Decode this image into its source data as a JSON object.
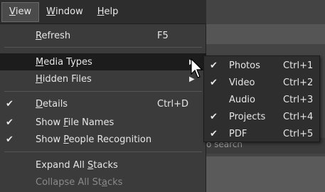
{
  "menubar": {
    "items": [
      {
        "label": "View",
        "active": true
      },
      {
        "label": "Window",
        "active": false
      },
      {
        "label": "Help",
        "active": false
      }
    ]
  },
  "view_menu": {
    "refresh": {
      "label": "Refresh",
      "shortcut": "F5"
    },
    "media_types": {
      "label": "Media Types"
    },
    "hidden_files": {
      "label": "Hidden Files"
    },
    "details": {
      "label": "Details",
      "shortcut": "Ctrl+D",
      "checked": true
    },
    "show_file_names": {
      "label": "Show File Names",
      "checked": true
    },
    "show_people_recognition": {
      "label": "Show People Recognition",
      "checked": true
    },
    "expand_all_stacks": {
      "label": "Expand All Stacks"
    },
    "collapse_all_stacks": {
      "label": "Collapse All Stacks",
      "disabled": true
    }
  },
  "media_types_submenu": {
    "items": [
      {
        "label": "Photos",
        "shortcut": "Ctrl+1",
        "checked": true
      },
      {
        "label": "Video",
        "shortcut": "Ctrl+2",
        "checked": true
      },
      {
        "label": "Audio",
        "shortcut": "Ctrl+3",
        "checked": false
      },
      {
        "label": "Projects",
        "shortcut": "Ctrl+4",
        "checked": true
      },
      {
        "label": "PDF",
        "shortcut": "Ctrl+5",
        "checked": true
      }
    ]
  },
  "background": {
    "search_fragment": "o search"
  },
  "icons": {
    "check": "✔",
    "submenu_arrow": "▶"
  }
}
